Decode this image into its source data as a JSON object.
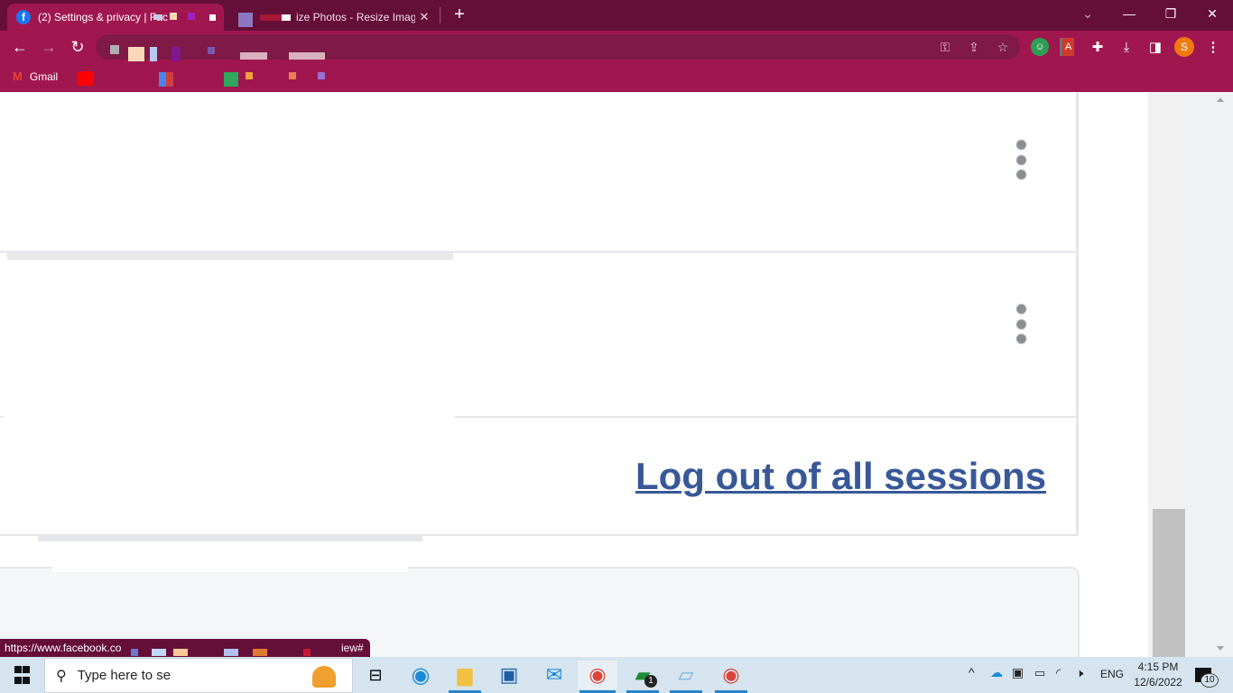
{
  "browser": {
    "tabs": [
      {
        "title": "(2) Settings & privacy | Fac",
        "favicon": "facebook-icon",
        "active": true
      },
      {
        "title": "ize Photos - Resize Image",
        "close_label": "✕",
        "active": false
      }
    ],
    "new_tab_label": "+",
    "window_controls": {
      "tab_search": "⌄",
      "minimize": "—",
      "restore": "❐",
      "close": "✕"
    },
    "nav": {
      "back": "←",
      "forward": "→",
      "reload": "↻"
    },
    "omnibox_icons": [
      "key-icon",
      "share-icon",
      "star-icon"
    ],
    "extensions": [
      "grammar-bot-extension-icon",
      "pdf-extension-icon",
      "puzzle-extensions-icon",
      "download-icon",
      "side-panel-icon"
    ],
    "profile_initial": "S",
    "menu_label": "⋮",
    "bookmarks": [
      {
        "label": "Gmail",
        "icon": "gmail-icon"
      },
      {
        "label": "",
        "icon": "youtube-icon"
      }
    ]
  },
  "page": {
    "logout_link": "Log out of all sessions",
    "session_rows": [
      {
        "menu": "more-options"
      },
      {
        "menu": "more-options"
      }
    ]
  },
  "status_bar": {
    "url_start": "https://www.facebook.co",
    "url_end": "iew#"
  },
  "taskbar": {
    "search_placeholder": "Type here to se",
    "apps": [
      "task-view",
      "edge",
      "file-explorer",
      "microsoft-store",
      "mail",
      "chrome-profile-s",
      "chat-1",
      "notepad",
      "chrome-profile-2"
    ],
    "chat_badge": "1",
    "tray": {
      "language": "ENG",
      "time": "4:15 PM",
      "date": "12/6/2022",
      "notifications": "10"
    }
  },
  "colors": {
    "chrome_frame": "#650e38",
    "chrome_toolbar": "#a0174f",
    "link": "#385898",
    "taskbar": "#d5e4ef"
  }
}
